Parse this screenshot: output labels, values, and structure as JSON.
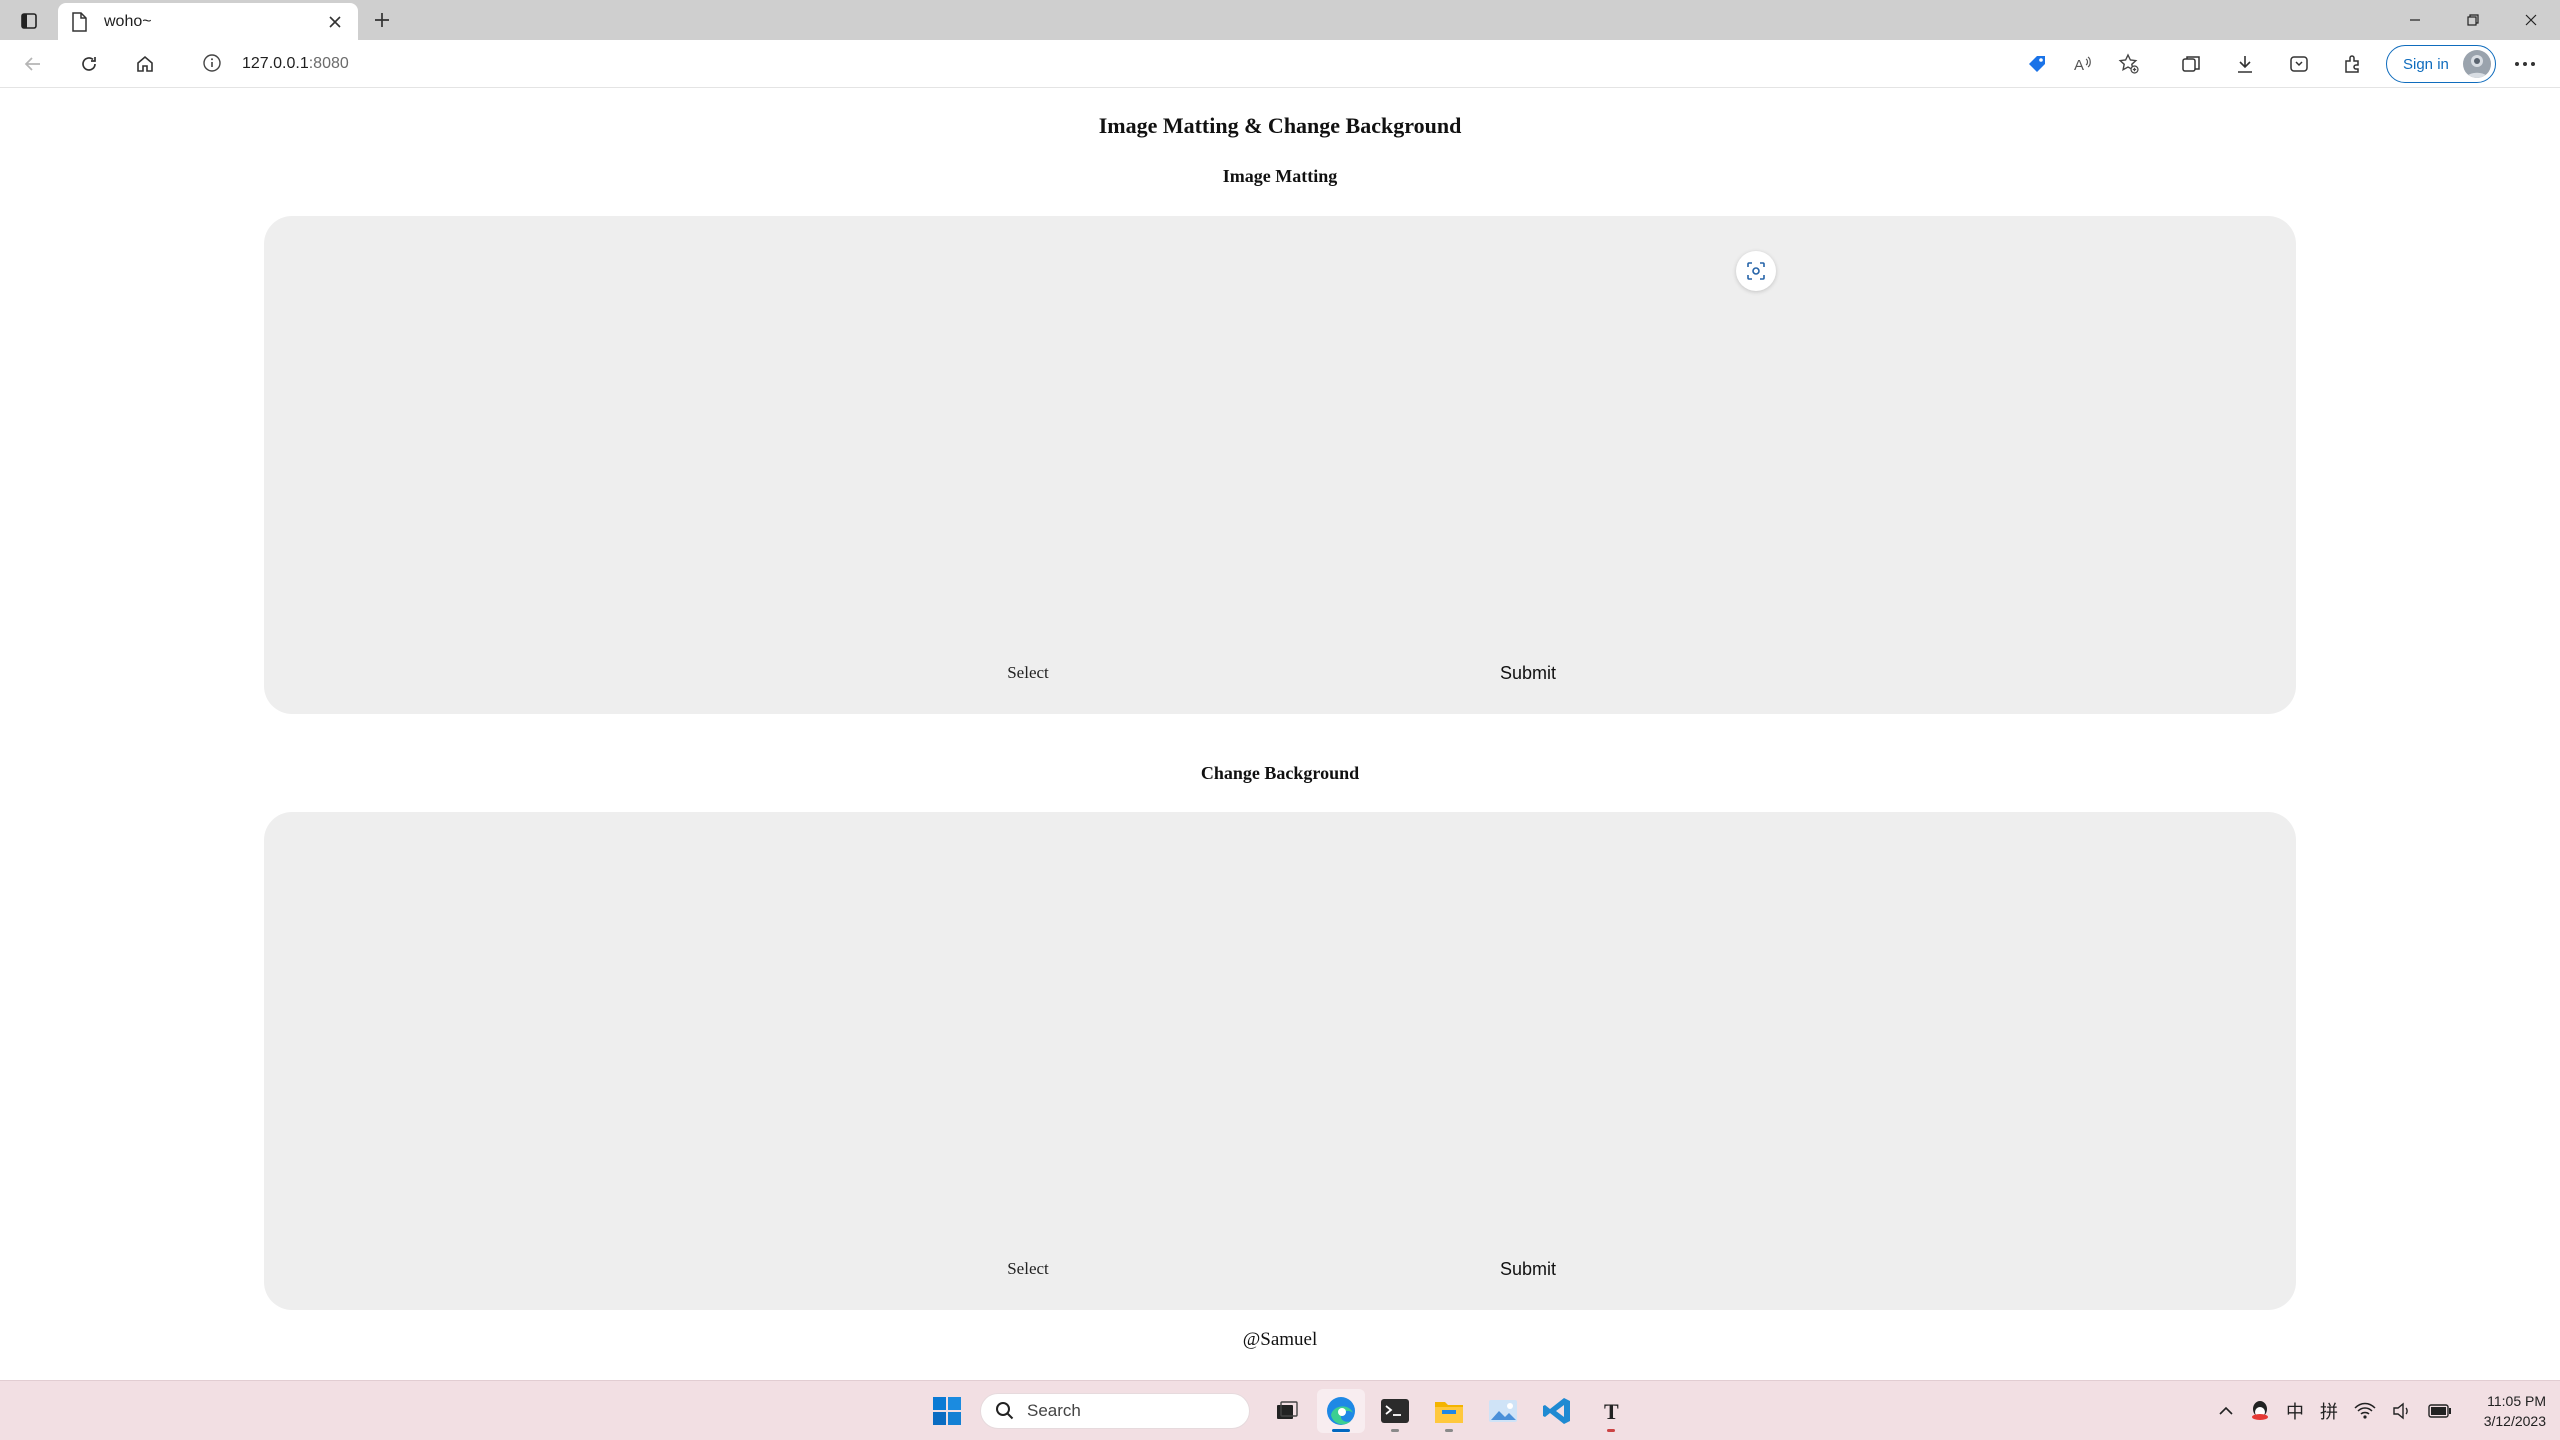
{
  "browser": {
    "tab_title": "woho~",
    "url_host": "127.0.0.1",
    "url_port": ":8080",
    "sign_in_label": "Sign in"
  },
  "page": {
    "title": "Image Matting & Change Background",
    "sections": [
      {
        "title": "Image Matting",
        "select_label": "Select",
        "submit_label": "Submit"
      },
      {
        "title": "Change Background",
        "select_label": "Select",
        "submit_label": "Submit"
      }
    ],
    "footer": "@Samuel"
  },
  "taskbar": {
    "search_placeholder": "Search",
    "ime_label": "中",
    "ime_mode": "拼",
    "time": "11:05 PM",
    "date": "3/12/2023"
  },
  "colors": {
    "panel_bg": "#eeeeee",
    "accent": "#0f6cbd",
    "taskbar_bg": "#f2dfe3",
    "tab_strip_bg": "#cfcfcf"
  }
}
